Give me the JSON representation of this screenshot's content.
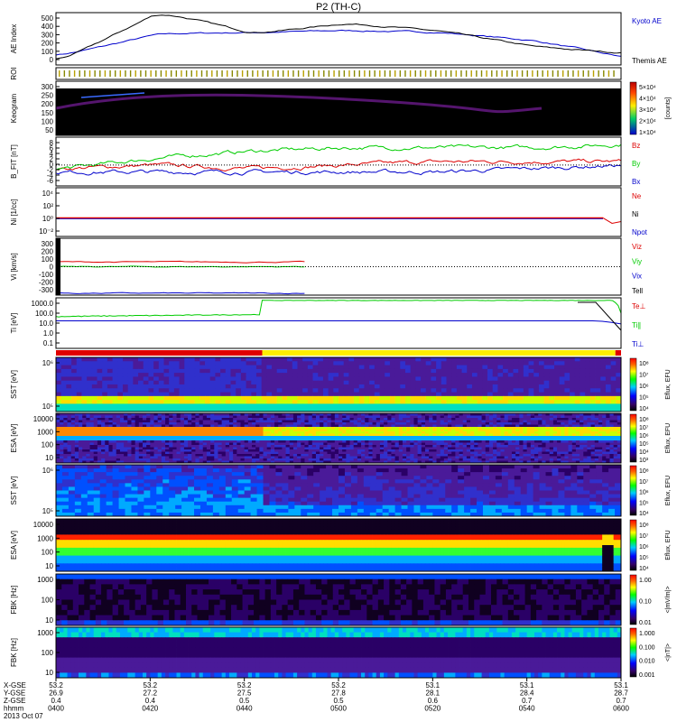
{
  "title": "P2 (TH-C)",
  "colors": {
    "kyoto": "#000000",
    "themis": "#0000cc",
    "red": "#dd0000",
    "green": "#00cc00",
    "blue": "#0000cc",
    "black": "#000000"
  },
  "panels": [
    {
      "id": "ae",
      "ylabel": "AE Index",
      "ticks": [
        "500",
        "400",
        "300",
        "200",
        "100",
        "0"
      ],
      "legend": [
        {
          "text": "Kyoto AE",
          "color": "#0000cc"
        },
        {
          "text": "Themis AE",
          "color": "#000000"
        }
      ]
    },
    {
      "id": "roi",
      "ylabel": "ROI",
      "ticks": [],
      "legend": []
    },
    {
      "id": "keogram",
      "ylabel": "Keogram",
      "ticks": [
        "300",
        "250",
        "200",
        "150",
        "100",
        "50"
      ],
      "legend": [],
      "colorbar": {
        "ticks": [
          "5×10⁴",
          "4×10⁴",
          "3×10⁴",
          "2×10⁴",
          "1×10⁴"
        ],
        "label": "[counts]"
      }
    },
    {
      "id": "bfield",
      "ylabel": "B_FIT [nT]",
      "ticks": [
        "8",
        "6",
        "4",
        "2",
        "0",
        "-2",
        "-4",
        "-6"
      ],
      "legend": [
        {
          "text": "Bz",
          "color": "#dd0000"
        },
        {
          "text": "By",
          "color": "#00cc00"
        },
        {
          "text": "Bx",
          "color": "#0000cc"
        }
      ]
    },
    {
      "id": "density",
      "ylabel": "Ni [1/cc]",
      "ticks": [
        "10⁴",
        "10²",
        "10⁰",
        "10⁻²"
      ],
      "legend": [
        {
          "text": "Ne",
          "color": "#dd0000"
        },
        {
          "text": "Ni",
          "color": "#000000"
        },
        {
          "text": "Npot",
          "color": "#0000cc"
        }
      ]
    },
    {
      "id": "velocity",
      "ylabel": "Vi [km/s]",
      "ticks": [
        "300",
        "200",
        "100",
        "0",
        "-100",
        "-200",
        "-300"
      ],
      "legend": [
        {
          "text": "Viz",
          "color": "#dd0000"
        },
        {
          "text": "Viy",
          "color": "#00cc00"
        },
        {
          "text": "Vix",
          "color": "#0000cc"
        },
        {
          "text": "Tell",
          "color": "#000000"
        }
      ]
    },
    {
      "id": "temp",
      "ylabel": "Ti [eV]",
      "ticks": [
        "1000.0",
        "100.0",
        "10.0",
        "1.0",
        "0.1"
      ],
      "legend": [
        {
          "text": "Te⊥",
          "color": "#dd0000"
        },
        {
          "text": "Ti∥",
          "color": "#00cc00"
        },
        {
          "text": "Ti⊥",
          "color": "#0000cc"
        }
      ]
    },
    {
      "id": "sst1",
      "ylabel": "SST [eV]",
      "ticks": [
        "10⁶",
        "10⁵"
      ],
      "legend": [],
      "colorbar": {
        "ticks": [
          "10⁸",
          "10⁷",
          "10⁶",
          "10⁵",
          "10⁴"
        ],
        "label": "Eflux, EFU"
      }
    },
    {
      "id": "esa1",
      "ylabel": "ESA [eV]",
      "ticks": [
        "10000",
        "1000",
        "100",
        "10"
      ],
      "legend": [],
      "colorbar": {
        "ticks": [
          "10⁸",
          "10⁷",
          "10⁶",
          "10⁵",
          "10⁴",
          "10³"
        ],
        "label": "Eflux, EFU"
      }
    },
    {
      "id": "sst2",
      "ylabel": "SST [eV]",
      "ticks": [
        "10⁶",
        "10⁵"
      ],
      "legend": [],
      "colorbar": {
        "ticks": [
          "10⁸",
          "10⁷",
          "10⁶",
          "10⁵",
          "10⁴"
        ],
        "label": "Eflux, EFU"
      }
    },
    {
      "id": "esa2",
      "ylabel": "ESA [eV]",
      "ticks": [
        "10000",
        "1000",
        "100",
        "10"
      ],
      "legend": [],
      "colorbar": {
        "ticks": [
          "10⁸",
          "10⁷",
          "10⁶",
          "10⁵",
          "10⁴"
        ],
        "label": "Eflux, EFU"
      }
    },
    {
      "id": "fbk1",
      "ylabel": "FBK [Hz]",
      "ticks": [
        "1000",
        "100",
        "10"
      ],
      "legend": [],
      "colorbar": {
        "ticks": [
          "1.00",
          "0.10",
          "0.01"
        ],
        "label": "<|mV/m|>"
      }
    },
    {
      "id": "fbk2",
      "ylabel": "FBK [Hz]",
      "ticks": [
        "1000",
        "100",
        "10"
      ],
      "legend": [],
      "colorbar": {
        "ticks": [
          "1.000",
          "0.100",
          "0.010",
          "0.001"
        ],
        "label": "<|nT|>"
      }
    }
  ],
  "time_axis": {
    "row_labels": [
      "X-GSE",
      "Y-GSE",
      "Z-GSE",
      "hhmm",
      "2013 Oct 07"
    ],
    "columns": [
      {
        "x": "53.2",
        "y": "26.9",
        "z": "0.4",
        "t": "0400"
      },
      {
        "x": "53.2",
        "y": "27.2",
        "z": "0.4",
        "t": "0420"
      },
      {
        "x": "53.2",
        "y": "27.5",
        "z": "0.5",
        "t": "0440"
      },
      {
        "x": "53.2",
        "y": "27.8",
        "z": "0.5",
        "t": "0500"
      },
      {
        "x": "53.1",
        "y": "28.1",
        "z": "0.6",
        "t": "0520"
      },
      {
        "x": "53.1",
        "y": "28.4",
        "z": "0.7",
        "t": "0540"
      },
      {
        "x": "53.1",
        "y": "28.7",
        "z": "0.7",
        "t": "0600"
      }
    ]
  },
  "chart_data": {
    "type": "line",
    "title": "P2 (TH-C)",
    "x": [
      "0400",
      "0420",
      "0440",
      "0500",
      "0520",
      "0540",
      "0600"
    ],
    "ae_index": {
      "ylim": [
        0,
        500
      ],
      "series": [
        {
          "name": "Kyoto AE",
          "values": [
            100,
            300,
            310,
            330,
            310,
            230,
            60
          ]
        },
        {
          "name": "Themis AE",
          "values": [
            60,
            510,
            300,
            400,
            320,
            170,
            110
          ]
        }
      ]
    },
    "b_field": {
      "ylim": [
        -6,
        8
      ],
      "series": [
        {
          "name": "Bz",
          "values": [
            -1,
            0,
            -1,
            0,
            1,
            1,
            1
          ]
        },
        {
          "name": "By",
          "values": [
            -1,
            2,
            4,
            5,
            5,
            5,
            6
          ]
        },
        {
          "name": "Bx",
          "values": [
            -2,
            -2,
            -2,
            -2,
            -2,
            -1,
            0
          ]
        }
      ]
    },
    "ion_velocity": {
      "ylim": [
        -300,
        300
      ],
      "series": [
        {
          "name": "Viz",
          "values": [
            50,
            50,
            50
          ]
        },
        {
          "name": "Viy",
          "values": [
            0,
            0,
            0
          ]
        },
        {
          "name": "Vix",
          "values": [
            -280,
            -280,
            -280
          ]
        }
      ]
    },
    "temperature": {
      "ylim": [
        0.1,
        1000
      ],
      "series": [
        {
          "name": "Ti∥",
          "values": [
            30,
            40,
            600,
            600,
            600,
            600,
            20
          ]
        },
        {
          "name": "Ti⊥",
          "values": [
            15,
            15,
            15,
            15,
            15,
            15,
            10
          ]
        }
      ]
    }
  }
}
